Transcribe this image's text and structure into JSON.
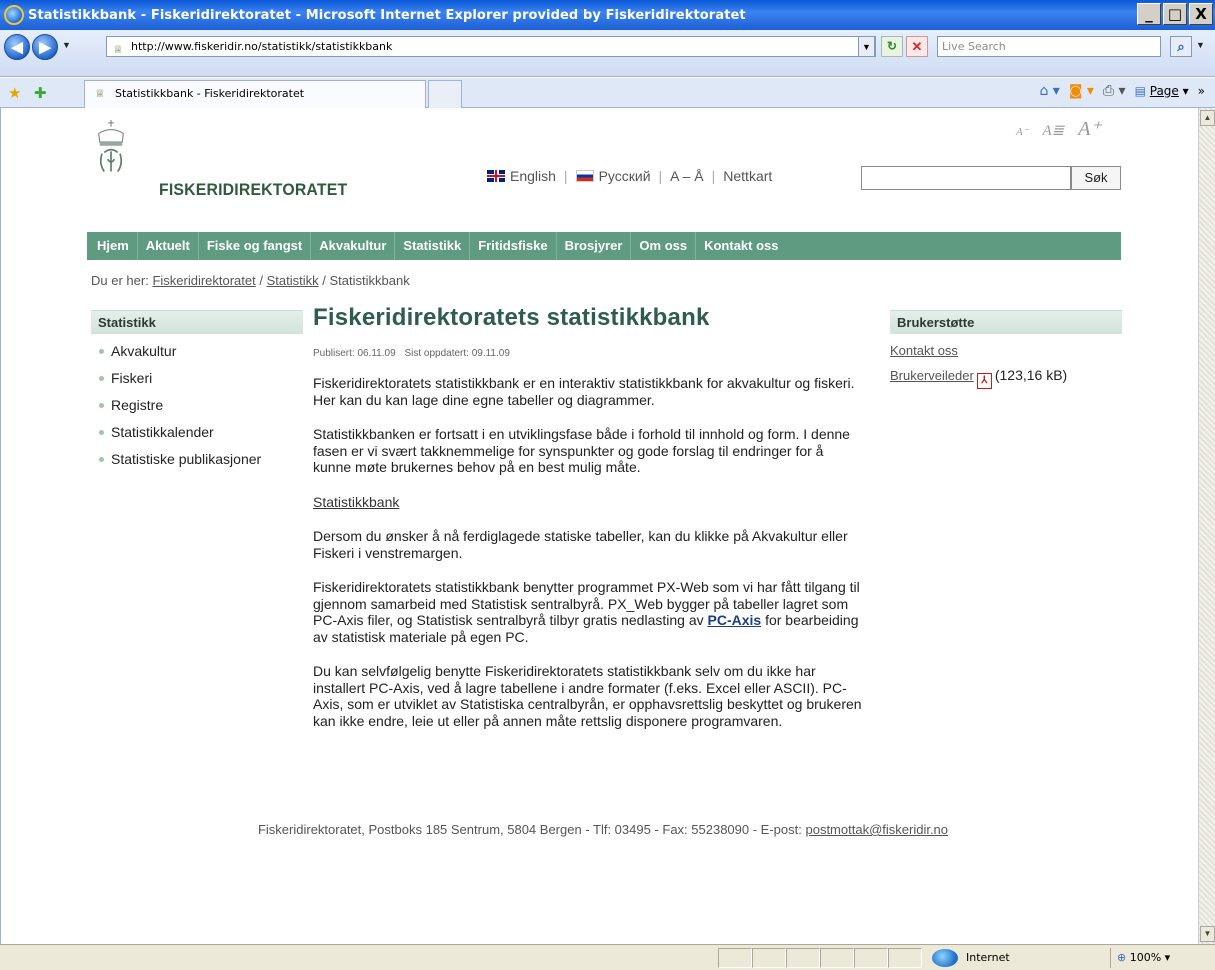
{
  "window": {
    "title": "Statistikkbank - Fiskeridirektoratet - Microsoft Internet Explorer provided by Fiskeridirektoratet",
    "minimize": "_",
    "maximize": "□",
    "close": "X"
  },
  "browser": {
    "url": "http://www.fiskeridir.no/statistikk/statistikkbank",
    "search_placeholder": "Live Search",
    "tab_title": "Statistikkbank - Fiskeridirektoratet",
    "page_menu": "Page",
    "overflow": "»"
  },
  "site": {
    "logo_text": "FISKERIDIREKTORATET",
    "font_tools": {
      "smaller": "A⁻",
      "normal": "A≣",
      "larger": "A⁺"
    },
    "lang_links": {
      "english": "English",
      "russian": "Русский",
      "az": "A – Å",
      "sitemap": "Nettkart"
    },
    "search_button": "Søk",
    "nav": [
      "Hjem",
      "Aktuelt",
      "Fiske og fangst",
      "Akvakultur",
      "Statistikk",
      "Fritidsfiske",
      "Brosjyrer",
      "Om oss",
      "Kontakt oss"
    ],
    "breadcrumb": {
      "prefix": "Du er her:",
      "items": [
        "Fiskeridirektoratet",
        "Statistikk",
        "Statistikkbank"
      ],
      "sep": "/"
    }
  },
  "left": {
    "heading": "Statistikk",
    "items": [
      "Akvakultur",
      "Fiskeri",
      "Registre",
      "Statistikkalender",
      "Statistiske publikasjoner"
    ]
  },
  "main": {
    "title": "Fiskeridirektoratets statistikkbank",
    "published": "Publisert: 06.11.09",
    "updated": "Sist oppdatert: 09.11.09",
    "p1": "Fiskeridirektoratets statistikkbank er en interaktiv statistikkbank for akvakultur og fiskeri. Her kan du kan lage dine egne tabeller og diagrammer.",
    "p2": "Statistikkbanken er fortsatt i en utviklingsfase både i forhold til innhold og form. I denne fasen er vi svært takknemmelige for synspunkter og gode forslag til endringer for å kunne møte brukernes behov på en best mulig måte.",
    "link_statistikkbank": "Statistikkbank",
    "p3": "Dersom du ønsker å nå ferdiglagede statiske tabeller, kan du klikke på Akvakultur eller Fiskeri i venstremargen.",
    "p4_a": "Fiskeridirektoratets statistikkbank benytter programmet PX-Web som vi har fått tilgang til gjennom samarbeid med Statistisk sentralbyrå. PX_Web bygger på tabeller lagret som PC-Axis filer, og Statistisk sentralbyrå tilbyr gratis nedlasting av",
    "p4_link": "PC-Axis",
    "p4_b": "for bearbeiding av statistisk materiale på egen PC.",
    "p5": "Du kan selvfølgelig benytte Fiskeridirektoratets statistikkbank selv om du ikke har installert PC-Axis, ved å lagre tabellene i andre formater (f.eks. Excel eller ASCII). PC-Axis, som er utviklet av Statistiska centralbyrån, er opphavsrettslig beskyttet og brukeren kan ikke endre, leie ut eller på annen måte rettslig disponere programvaren."
  },
  "right": {
    "heading": "Brukerstøtte",
    "contact": "Kontakt oss",
    "guide": "Brukerveileder",
    "guide_size": "(123,16 kB)"
  },
  "footer": {
    "text": "Fiskeridirektoratet, Postboks 185 Sentrum, 5804 Bergen - Tlf: 03495 - Fax: 55238090 - E-post:",
    "email": "postmottak@fiskeridir.no"
  },
  "status": {
    "zone": "Internet",
    "zoom": "100%"
  }
}
